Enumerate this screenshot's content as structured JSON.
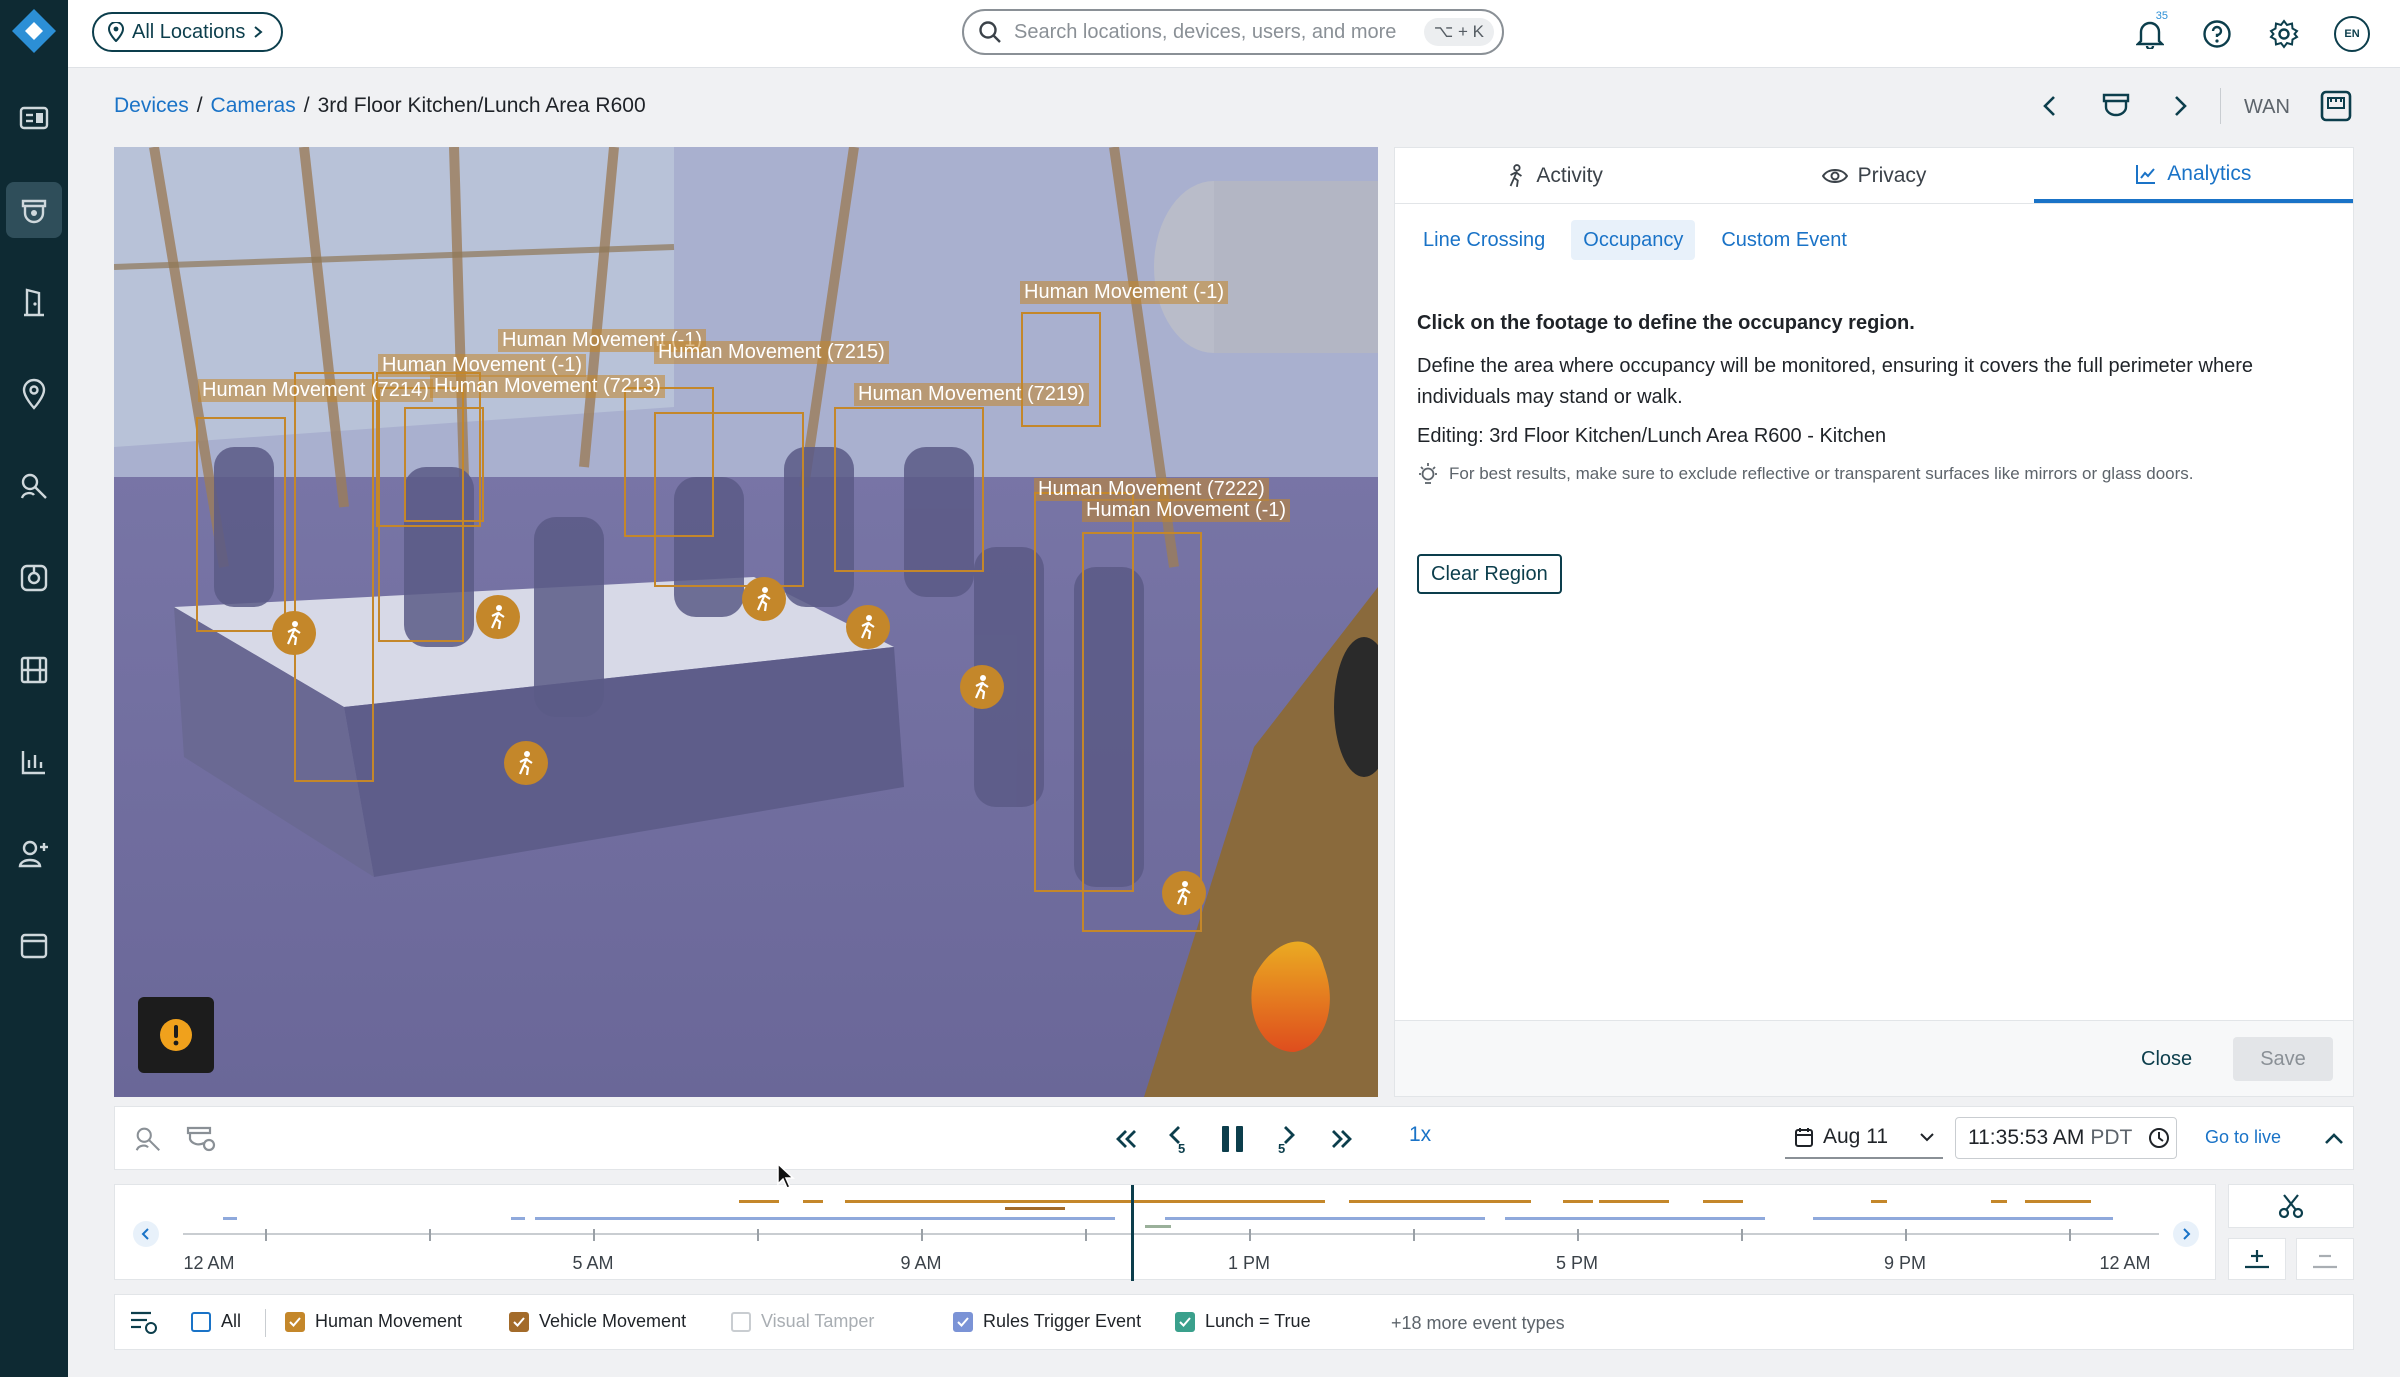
{
  "nav": {
    "location_pill": "All Locations",
    "search_placeholder": "Search locations, devices, users, and more",
    "search_shortcut": "⌥ + K",
    "notification_count": "35",
    "language": "EN"
  },
  "sidebar": {
    "items": [
      {
        "icon": "dashboard-icon",
        "active": false
      },
      {
        "icon": "camera-devices-icon",
        "active": true
      },
      {
        "icon": "door-access-icon",
        "active": false
      },
      {
        "icon": "map-pin-icon",
        "active": false
      },
      {
        "icon": "person-search-icon",
        "active": false
      },
      {
        "icon": "sensor-icon",
        "active": false
      },
      {
        "icon": "video-clips-icon",
        "active": false
      },
      {
        "icon": "analytics-chart-icon",
        "active": false
      },
      {
        "icon": "add-user-icon",
        "active": false
      },
      {
        "icon": "browser-window-icon",
        "active": false
      }
    ]
  },
  "breadcrumb": {
    "devices": "Devices",
    "cameras": "Cameras",
    "current": "3rd Floor Kitchen/Lunch Area R600",
    "network": "WAN"
  },
  "video": {
    "detections": [
      {
        "label": "Human Movement (-1)"
      },
      {
        "label": "Human Movement (-1)"
      },
      {
        "label": "Human Movement (7215)"
      },
      {
        "label": "Human Movement (-1)"
      },
      {
        "label": "Human Movement (7214)"
      },
      {
        "label": "Human Movement (7213)"
      },
      {
        "label": "Human Movement (7219)"
      },
      {
        "label": "Human Movement (7222)"
      },
      {
        "label": "Human Movement (-1)"
      }
    ]
  },
  "panel": {
    "tabs": [
      {
        "label": "Activity",
        "icon": "walking-person-icon",
        "active": false
      },
      {
        "label": "Privacy",
        "icon": "eye-icon",
        "active": false
      },
      {
        "label": "Analytics",
        "icon": "analytics-icon",
        "active": true
      }
    ],
    "subtabs": [
      {
        "label": "Line Crossing",
        "active": false
      },
      {
        "label": "Occupancy",
        "active": true
      },
      {
        "label": "Custom Event",
        "active": false
      }
    ],
    "heading": "Click on the footage to define the occupancy region.",
    "description": "Define the area where occupancy will be monitored, ensuring it covers the full perimeter where individuals may stand or walk.",
    "editing": "Editing: 3rd Floor Kitchen/Lunch Area R600 - Kitchen",
    "tip": "For best results, make sure to exclude reflective or transparent surfaces like mirrors or glass doors.",
    "clear_button": "Clear Region",
    "close_button": "Close",
    "save_button": "Save"
  },
  "playback": {
    "speed": "1x",
    "date": "Aug 11",
    "time": "11:35:53 AM",
    "timezone": "PDT",
    "go_live": "Go to live"
  },
  "timeline": {
    "ticks": [
      "12 AM",
      "5 AM",
      "9 AM",
      "1 PM",
      "5 PM",
      "9 PM",
      "12 AM"
    ],
    "colors": {
      "human": "#c4872a",
      "rules": "#8fa9dc",
      "other": "#9ab09a"
    }
  },
  "filters": {
    "items": [
      {
        "label": "All",
        "checked": false,
        "color": "#1a73c7",
        "disabled": false
      },
      {
        "label": "Human Movement",
        "checked": true,
        "color": "#c4872a",
        "disabled": false
      },
      {
        "label": "Vehicle Movement",
        "checked": true,
        "color": "#a36b2a",
        "disabled": false
      },
      {
        "label": "Visual Tamper",
        "checked": false,
        "color": "#c9cdd1",
        "disabled": true
      },
      {
        "label": "Rules Trigger Event",
        "checked": true,
        "color": "#7b93d6",
        "disabled": false
      },
      {
        "label": "Lunch = True",
        "checked": true,
        "color": "#3aa08c",
        "disabled": false
      }
    ],
    "more": "+18 more event types"
  }
}
